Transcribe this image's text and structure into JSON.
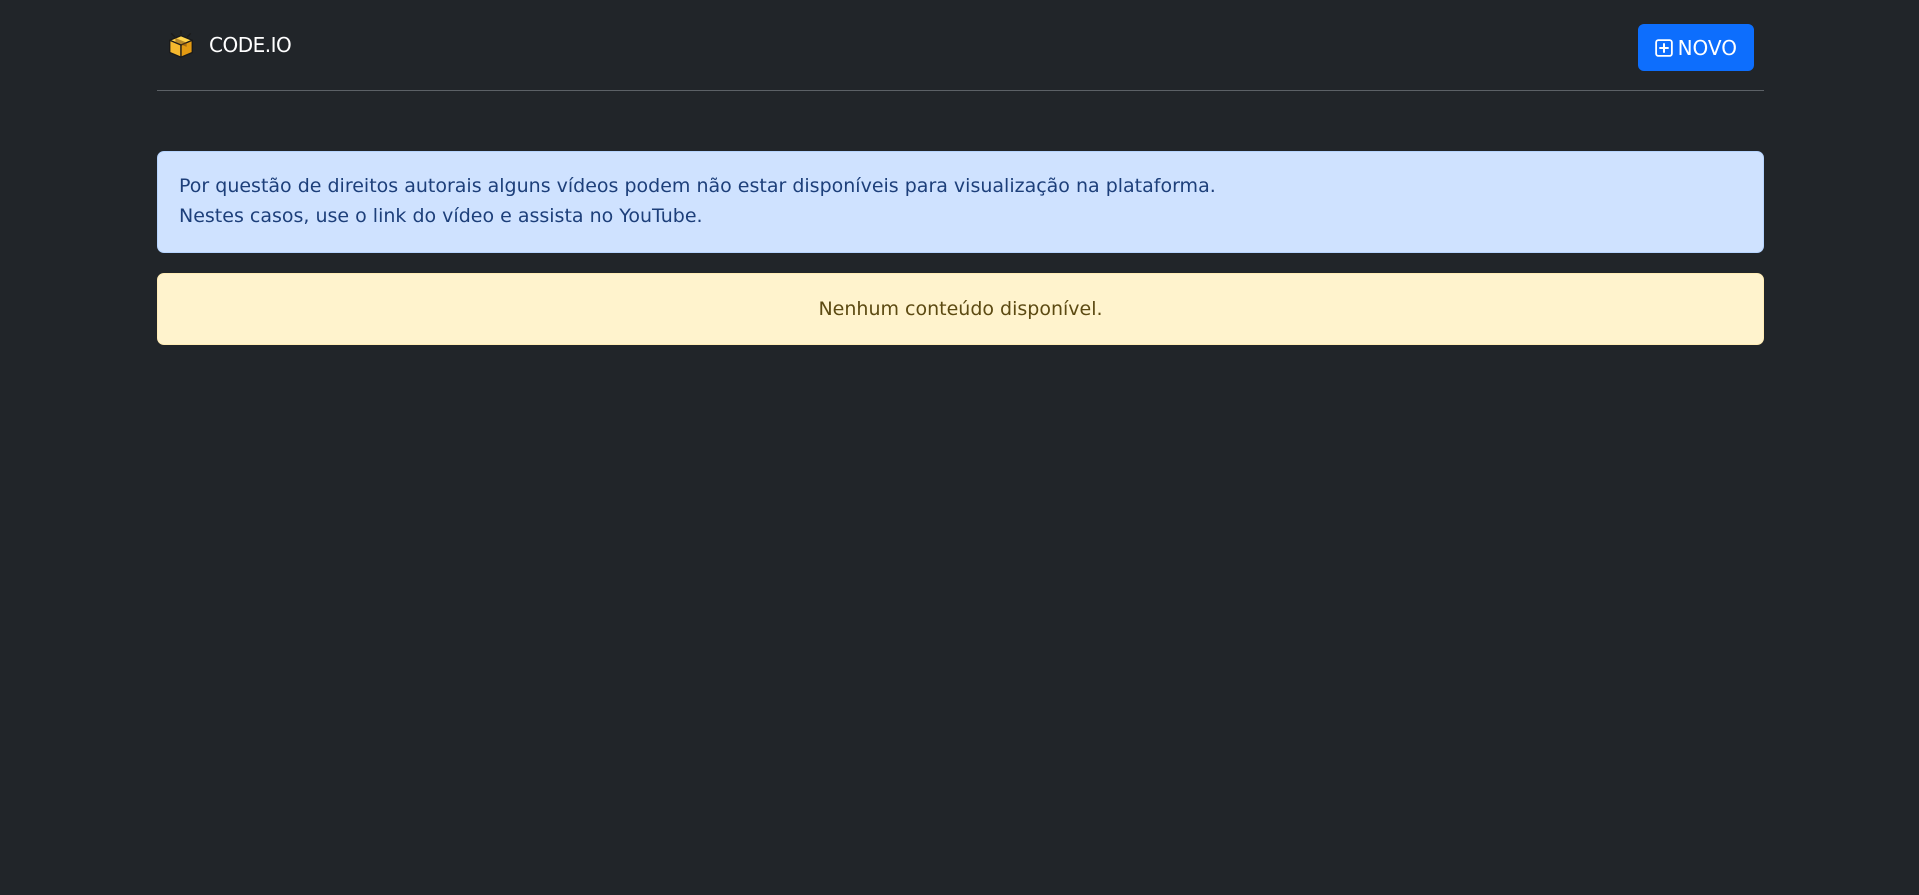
{
  "header": {
    "brand": {
      "icon": "package-box-icon",
      "name": "CODE.IO"
    },
    "new_button": {
      "icon": "plus-square-icon",
      "label": "NOVO"
    }
  },
  "notice": {
    "line1": "Por questão de direitos autorais alguns vídeos podem não estar disponíveis para visualização na plataforma.",
    "line2": "Nestes casos, use o link do vídeo e assista no YouTube."
  },
  "empty_state": {
    "message": "Nenhum conteúdo disponível."
  },
  "colors": {
    "background": "#212529",
    "primary": "#0d6efd",
    "info_bg": "#cfe2ff",
    "warning_bg": "#fff3cd",
    "brand_icon": "#f5b82e"
  }
}
